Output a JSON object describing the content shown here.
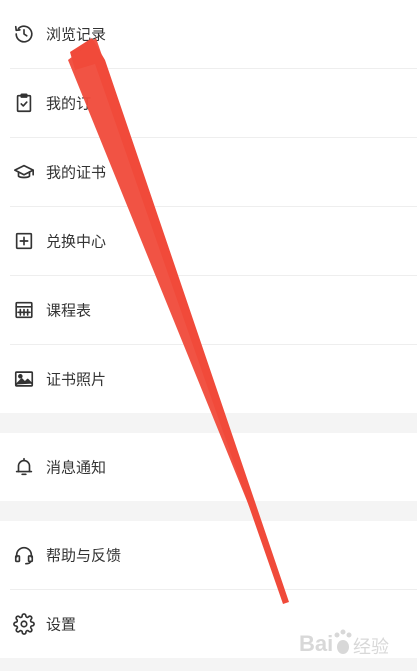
{
  "menu": {
    "items": [
      {
        "label": "浏览记录",
        "icon": "history-icon"
      },
      {
        "label": "我的订",
        "icon": "clipboard-check-icon"
      },
      {
        "label": "我的证书",
        "icon": "graduation-cap-icon"
      },
      {
        "label": "兑换中心",
        "icon": "plus-square-icon"
      },
      {
        "label": "课程表",
        "icon": "calendar-icon"
      },
      {
        "label": "证书照片",
        "icon": "image-icon"
      },
      {
        "label": "消息通知",
        "icon": "bell-icon"
      },
      {
        "label": "帮助与反馈",
        "icon": "headset-icon"
      },
      {
        "label": "设置",
        "icon": "gear-icon"
      }
    ]
  },
  "colors": {
    "text": "#333333",
    "icon": "#333333",
    "section_gap": "#f4f4f4",
    "divider": "#eeeeee",
    "annotation_arrow": "#f04a3a"
  },
  "watermark": {
    "logo": "Baidu 经验"
  }
}
